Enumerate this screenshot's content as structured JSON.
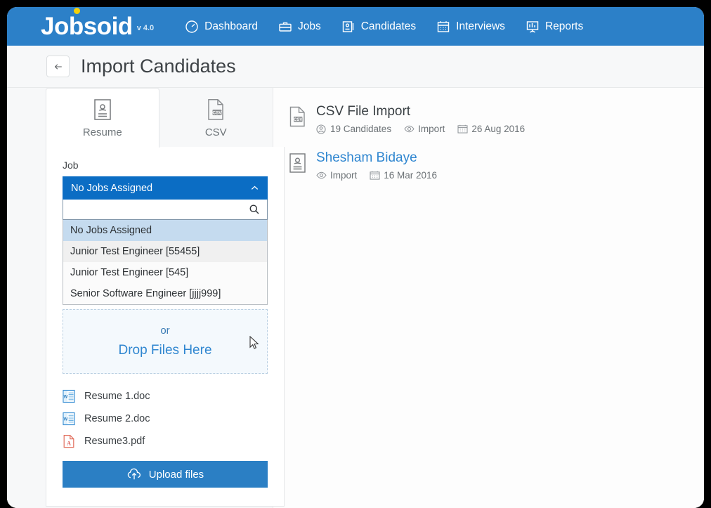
{
  "app": {
    "brand": "Jobsoid",
    "version": "v 4.0",
    "brand_color": "#2c80c8"
  },
  "nav": {
    "items": [
      {
        "label": "Dashboard",
        "icon": "dashboard-gauge-icon"
      },
      {
        "label": "Jobs",
        "icon": "briefcase-icon"
      },
      {
        "label": "Candidates",
        "icon": "id-card-icon"
      },
      {
        "label": "Interviews",
        "icon": "calendar-icon"
      },
      {
        "label": "Reports",
        "icon": "bar-chart-icon"
      }
    ]
  },
  "header": {
    "back_label": "←",
    "title": "Import Candidates"
  },
  "tabs": [
    {
      "label": "Resume",
      "icon": "resume-document-icon",
      "active": true
    },
    {
      "label": "CSV",
      "icon": "csv-file-icon",
      "active": false
    }
  ],
  "form": {
    "job_label": "Job",
    "select": {
      "value": "No Jobs Assigned",
      "search_value": "",
      "search_placeholder": "",
      "options": [
        {
          "label": "No Jobs Assigned",
          "state": "selected"
        },
        {
          "label": "Junior Test Engineer [55455]",
          "state": "hovered"
        },
        {
          "label": "Junior Test Engineer [545]",
          "state": "normal"
        },
        {
          "label": "Senior Software Engineer [jjjj999]",
          "state": "normal"
        }
      ]
    },
    "dropzone": {
      "or_text": "or",
      "main_text": "Drop Files Here"
    },
    "files": [
      {
        "name": "Resume 1.doc",
        "icon": "word-doc-icon"
      },
      {
        "name": "Resume 2.doc",
        "icon": "word-doc-icon"
      },
      {
        "name": "Resume3.pdf",
        "icon": "pdf-file-icon"
      }
    ],
    "upload_button": {
      "label": "Upload files",
      "icon": "cloud-upload-icon",
      "color": "#2b7fc4"
    }
  },
  "imports": [
    {
      "title": "CSV File Import",
      "is_link": false,
      "thumb_icon": "csv-file-icon",
      "meta": [
        {
          "icon": "candidate-icon",
          "text": "19 Candidates"
        },
        {
          "icon": "import-icon",
          "text": "Import"
        },
        {
          "icon": "calendar-icon",
          "text": "26 Aug 2016"
        }
      ]
    },
    {
      "title": "Shesham Bidaye",
      "is_link": true,
      "thumb_icon": "resume-document-icon",
      "meta": [
        {
          "icon": "import-icon",
          "text": "Import"
        },
        {
          "icon": "calendar-icon",
          "text": "16 Mar 2016"
        }
      ]
    }
  ]
}
